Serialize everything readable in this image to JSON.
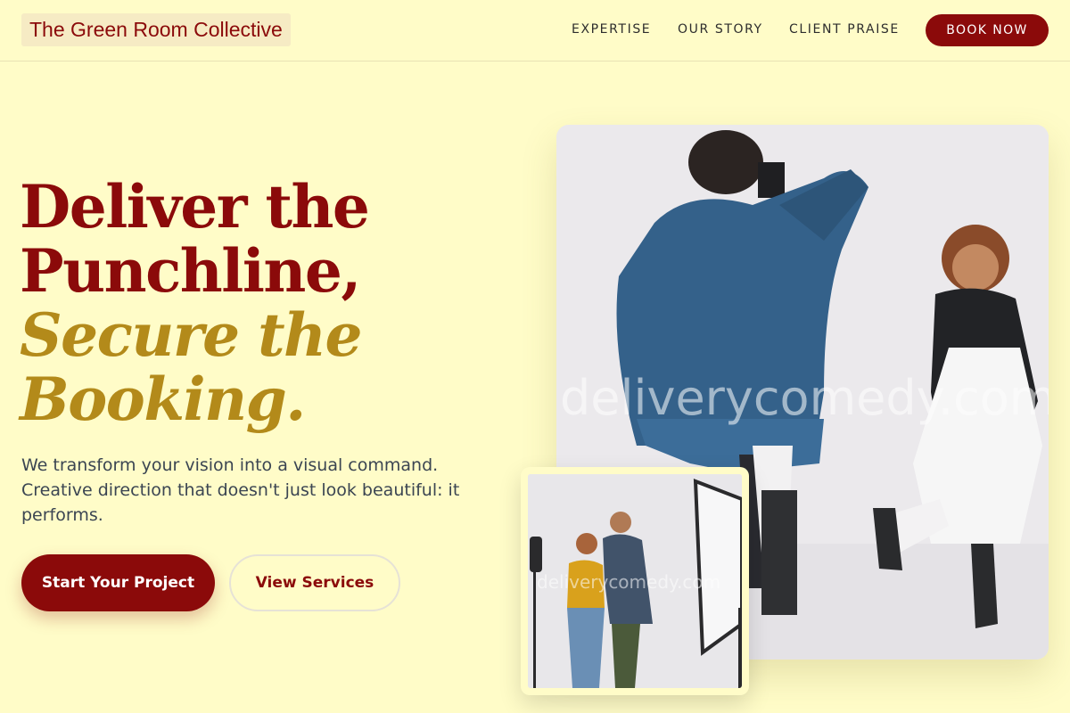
{
  "brand": {
    "name": "The Green Room Collective"
  },
  "nav": {
    "links": [
      "EXPERTISE",
      "OUR STORY",
      "CLIENT PRAISE"
    ],
    "cta": "BOOK NOW"
  },
  "hero": {
    "headline_line1": "Deliver the",
    "headline_line2": "Punchline,",
    "headline_accent1": "Secure the",
    "headline_accent2": "Booking.",
    "subtext": "We transform your vision into a visual command. Creative direction that doesn't just look beautiful: it performs.",
    "primary_button": "Start Your Project",
    "secondary_button": "View Services"
  },
  "images": {
    "main_watermark": "deliverycomedy.com",
    "inset_watermark": "deliverycomedy.com"
  },
  "colors": {
    "background": "#fffcc8",
    "brand_red": "#8b0a0a",
    "accent_gold": "#b38a1a",
    "body_text": "#3b4552"
  }
}
